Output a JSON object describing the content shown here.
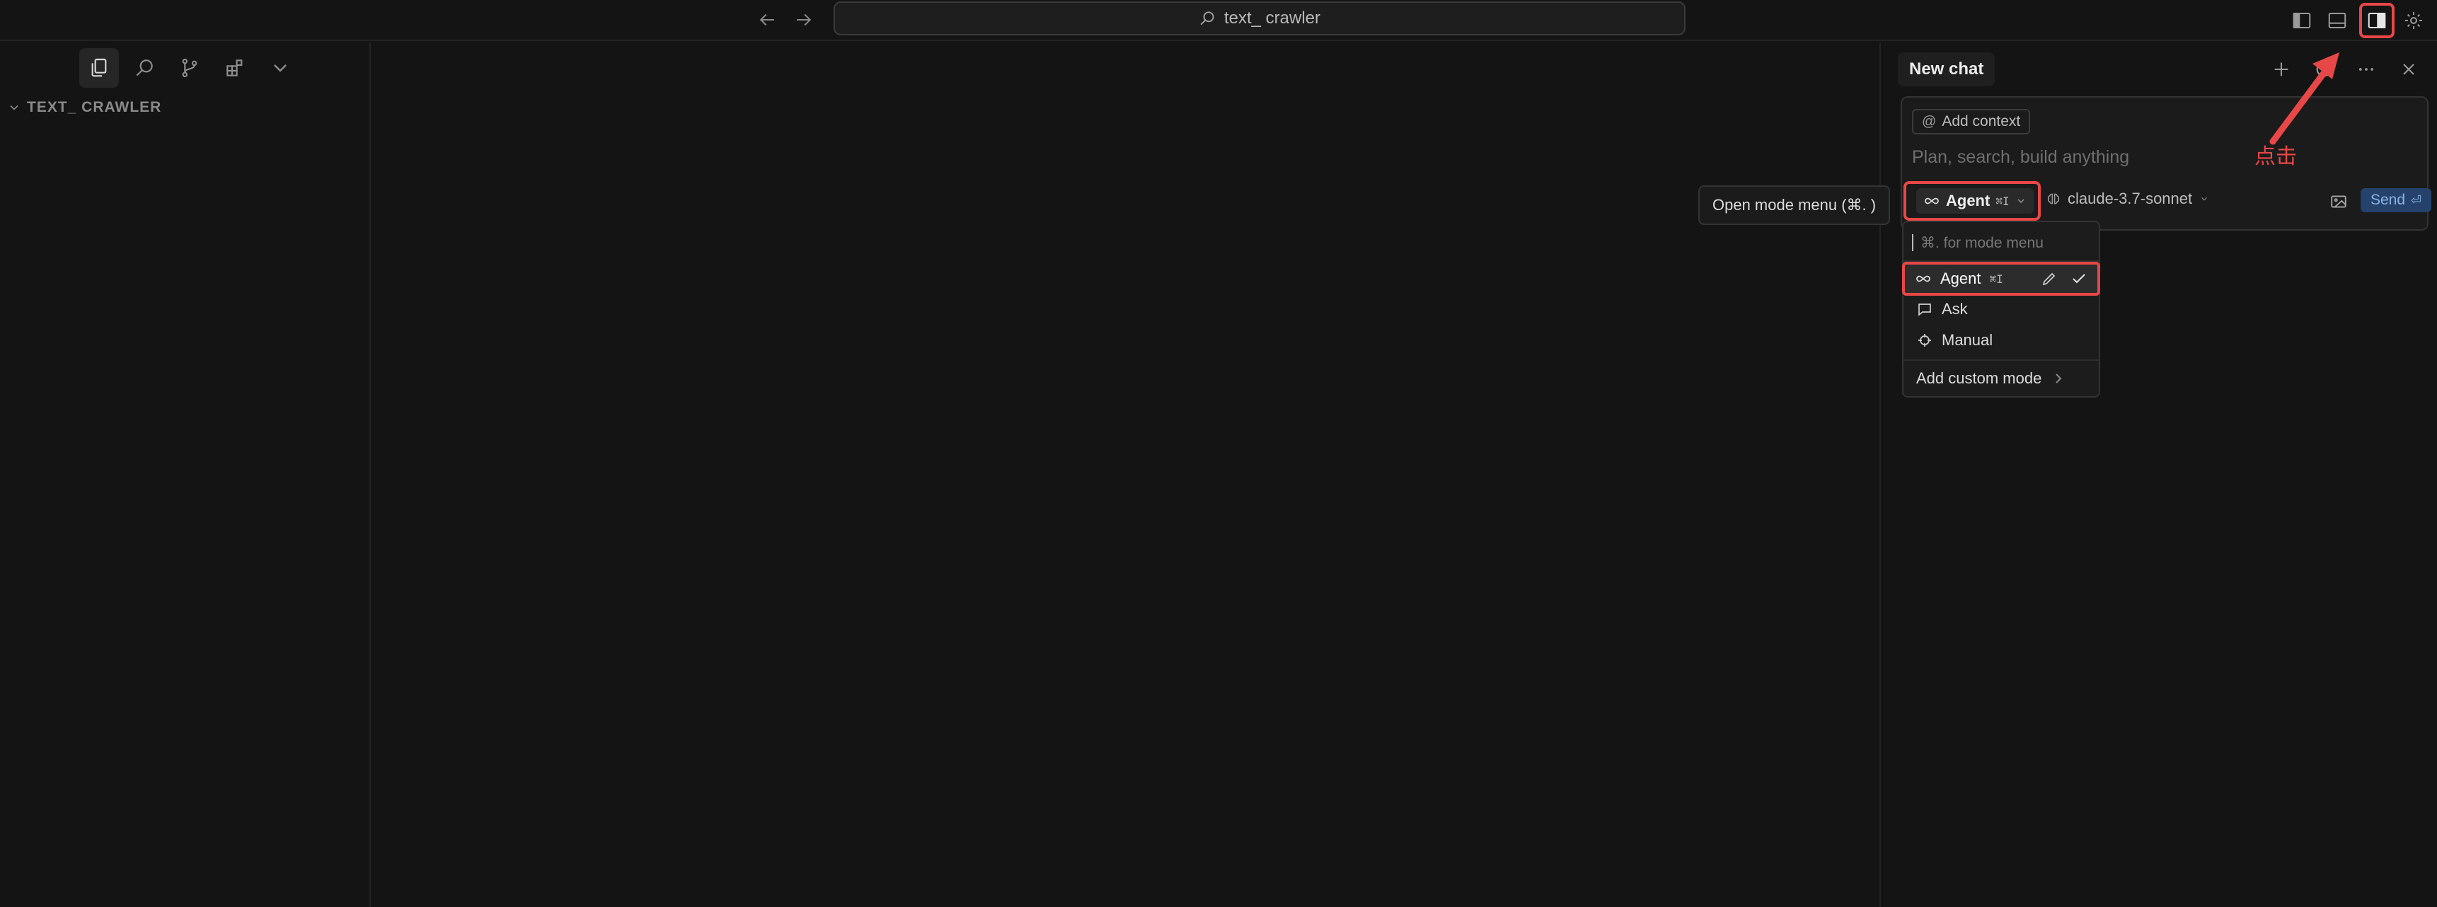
{
  "titlebar": {
    "search_text": "text_ crawler",
    "nav_back_icon": "arrow-left-icon",
    "nav_forward_icon": "arrow-right-icon"
  },
  "sidebar": {
    "root_label": "TEXT_ CRAWLER",
    "tools": [
      "explorer-icon",
      "search-icon",
      "source-control-icon",
      "extensions-icon",
      "chevron-down-icon"
    ]
  },
  "chat": {
    "tab_label": "New chat",
    "add_context_label": "Add context",
    "input_placeholder": "Plan, search, build anything",
    "mode_label": "Agent",
    "mode_shortcut": "⌘I",
    "model_label": "claude-3.7-sonnet",
    "send_label": "Send",
    "send_shortcut": "⏎"
  },
  "tooltip": {
    "text": "Open mode menu (⌘. )"
  },
  "mode_menu": {
    "search_placeholder": "⌘. for mode menu",
    "items": [
      {
        "label": "Agent",
        "shortcut": "⌘I",
        "icon": "infinity-icon",
        "selected": true
      },
      {
        "label": "Ask",
        "shortcut": "",
        "icon": "chat-bubble-icon",
        "selected": false
      },
      {
        "label": "Manual",
        "shortcut": "",
        "icon": "crosshair-icon",
        "selected": false
      }
    ],
    "add_custom_label": "Add custom mode"
  },
  "annotation": {
    "click_text": "点击",
    "color": "#e84747"
  },
  "colors": {
    "background": "#141414",
    "accent_send": "#24426b",
    "highlight": "#e84747"
  }
}
